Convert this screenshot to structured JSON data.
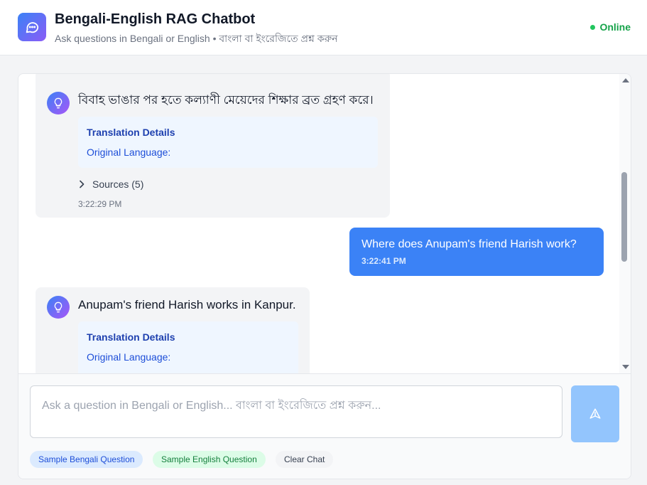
{
  "header": {
    "title": "Bengali-English RAG Chatbot",
    "subtitle": "Ask questions in Bengali or English • বাংলা বা ইংরেজিতে প্রশ্ন করুন",
    "status": "Online",
    "logo_icon": "chat-bubble-icon",
    "status_color": "#22c55e"
  },
  "messages": [
    {
      "role": "bot",
      "text": "বিবাহ ভাঙার পর হতে কল্যাণী মেয়েদের শিক্ষার ব্রত গ্রহণ করে।",
      "translation_title": "Translation Details",
      "translation_lang": "Original Language:",
      "sources_label": "Sources (5)",
      "time": "3:22:29 PM",
      "avatar_icon": "lightbulb-icon"
    },
    {
      "role": "user",
      "text": "Where does Anupam's friend Harish work?",
      "time": "3:22:41 PM"
    },
    {
      "role": "bot",
      "text": "Anupam's friend Harish works in Kanpur.",
      "translation_title": "Translation Details",
      "translation_lang": "Original Language:",
      "avatar_icon": "lightbulb-icon"
    }
  ],
  "input": {
    "placeholder": "Ask a question in Bengali or English... বাংলা বা ইংরেজিতে প্রশ্ন করুন...",
    "value": "",
    "send_icon": "send-icon"
  },
  "quick_actions": {
    "bengali": "Sample Bengali Question",
    "english": "Sample English Question",
    "clear": "Clear Chat"
  },
  "colors": {
    "accent": "#3b82f6",
    "accent_secondary": "#8b5cf6",
    "user_bubble": "#3b82f6",
    "bot_bubble": "#f3f4f6",
    "translation_bg": "#eff6ff"
  }
}
